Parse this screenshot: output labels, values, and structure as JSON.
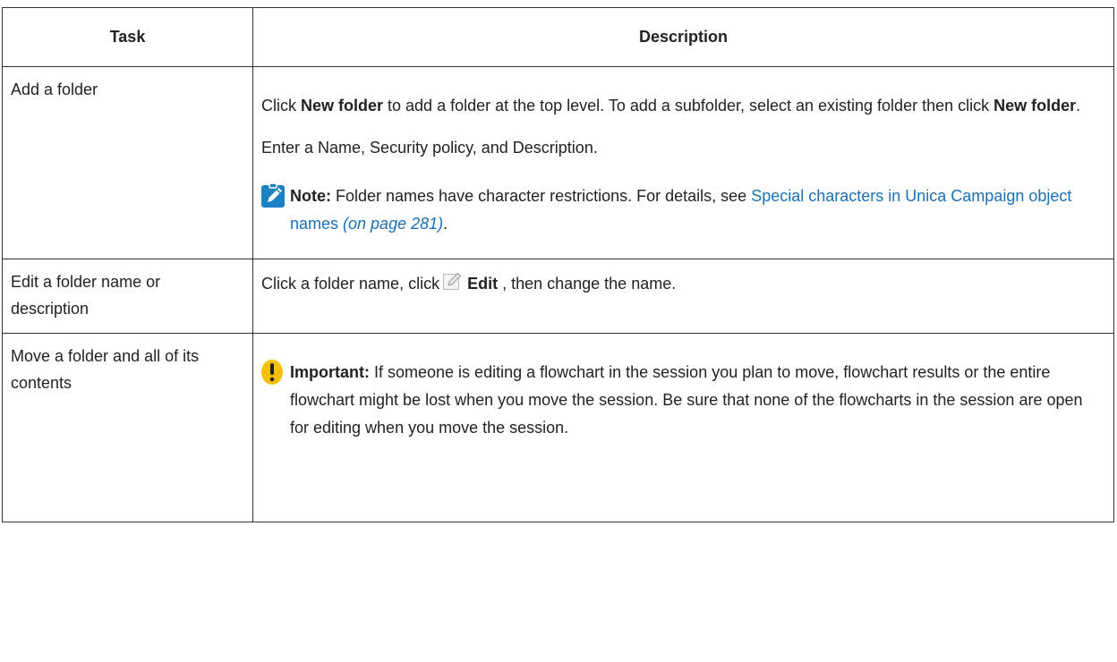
{
  "table": {
    "headers": {
      "task": "Task",
      "description": "Description"
    },
    "rows": [
      {
        "task": "Add a folder",
        "desc": {
          "p1_a": "Click ",
          "p1_b": "New folder",
          "p1_c": " to add a folder at the top level. To add a subfolder, select an existing folder then click ",
          "p1_d": "New folder",
          "p1_e": ".",
          "p2": "Enter a Name, Security policy, and Description.",
          "note_label": "Note:",
          "note_text": " Folder names have character restrictions. For details, see ",
          "note_link": "Special characters in Unica Campaign object names",
          "note_page": " (on page 281)",
          "note_end": "."
        }
      },
      {
        "task": "Edit a folder name or description",
        "desc": {
          "a": "Click a folder name, click",
          "b": "Edit",
          "c": " , then change the name."
        }
      },
      {
        "task": "Move a folder and all of its contents",
        "desc": {
          "label": "Important:",
          "text": " If someone is editing a flowchart in the session you plan to move, flowchart results or the entire flowchart might be lost when you move the session. Be sure that none of the flowcharts in the session are open for editing when you move the session."
        }
      }
    ]
  },
  "icons": {
    "note": "pencil-note-icon",
    "edit": "edit-icon",
    "important": "exclamation-icon"
  },
  "colors": {
    "note_icon": "#1a82c4",
    "important_icon": "#f2c200",
    "link": "#1a6fb7"
  }
}
